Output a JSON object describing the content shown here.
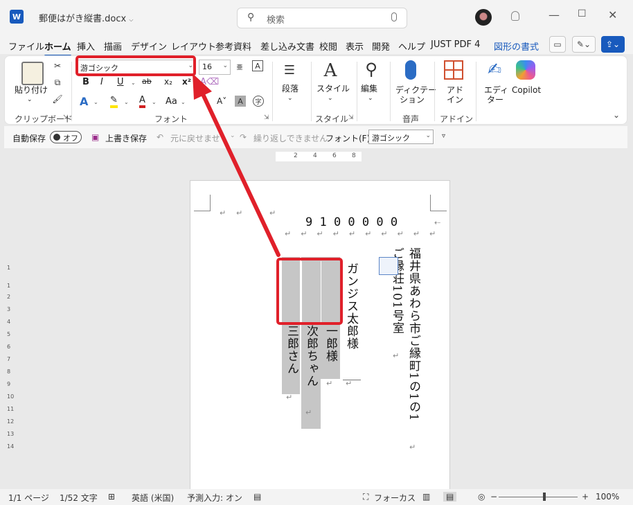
{
  "titlebar": {
    "doc_title": "郵便はがき縦書.docx",
    "search_placeholder": "検索"
  },
  "tabs": [
    "ファイル",
    "ホーム",
    "挿入",
    "描画",
    "デザイン",
    "レイアウト",
    "参考資料",
    "差し込み文書",
    "校閲",
    "表示",
    "開発",
    "ヘルプ",
    "JUST PDF 4",
    "図形の書式"
  ],
  "ribbon": {
    "paste_label": "貼り付け",
    "clipboard_group": "クリップボード",
    "font_name": "游ゴシック",
    "font_size": "16",
    "font_group": "フォント",
    "paragraph_label": "段落",
    "styles_label": "スタイル",
    "styles_group": "スタイル",
    "editing_label": "編集",
    "dictate_label1": "ディクテー",
    "dictate_label2": "ション",
    "voice_group": "音声",
    "addin_label1": "アド",
    "addin_label2": "イン",
    "addin_group": "アドイン",
    "editor_label1": "エディ",
    "editor_label2": "ター",
    "copilot_label": "Copilot",
    "bold": "B",
    "italic": "I",
    "underline": "U",
    "strike": "ab",
    "subscript": "x₂",
    "superscript": "x²",
    "case": "Aa"
  },
  "qat": {
    "autosave": "自動保存",
    "toggle": "オフ",
    "save": "上書き保存",
    "undo": "元に戻せませ",
    "redo": "繰り返しできません",
    "font_label": "フォント(F):",
    "font_value": "游ゴシック"
  },
  "ruler": [
    "2",
    "4",
    "6",
    "8"
  ],
  "vruler": [
    "1",
    "1",
    "2",
    "3",
    "4",
    "5",
    "6",
    "7",
    "8",
    "9",
    "10",
    "11",
    "12",
    "13",
    "14"
  ],
  "document": {
    "postal_code": "9 1 0 0 0 0 0",
    "address_line1": "福井県あわら市ご縁町1の1の1",
    "address_line2": "ご縁荘101号室",
    "recipient1": "ガンジス太郎様",
    "recipient2": "一郎様",
    "recipient3": "次郎ちゃん",
    "recipient4": "三郎さん"
  },
  "status": {
    "page": "1/1 ページ",
    "words": "1/52 文字",
    "language": "英語 (米国)",
    "predict": "予測入力: オン",
    "focus": "フォーカス",
    "zoom": "100%"
  },
  "colors": {
    "accent": "#185abd",
    "highlight_red": "#e0202a"
  }
}
